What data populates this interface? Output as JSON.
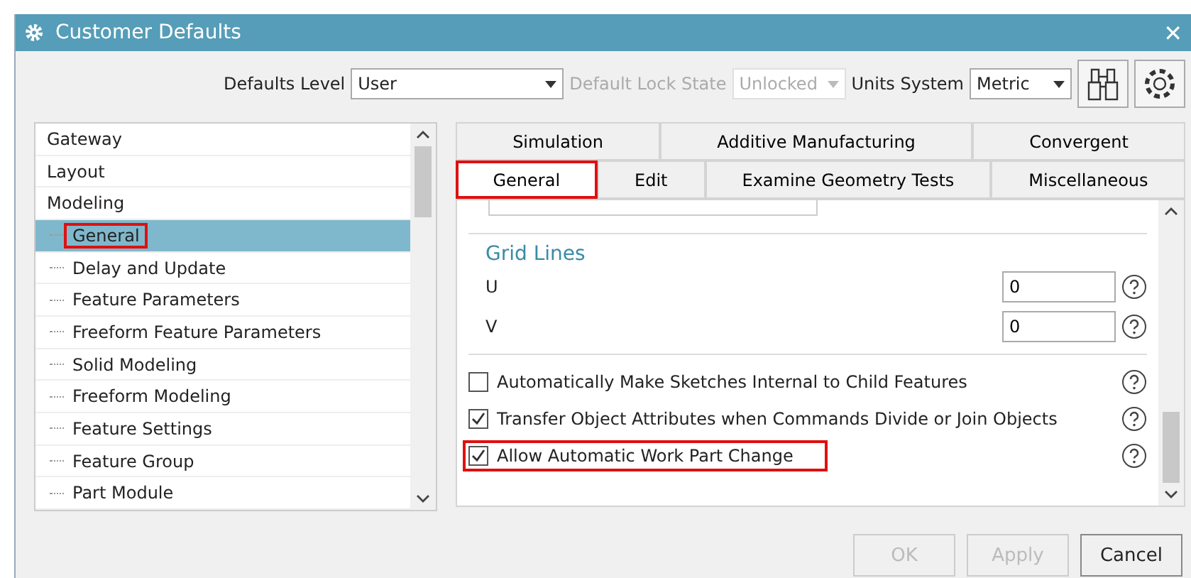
{
  "window": {
    "title": "Customer Defaults",
    "close": "✕"
  },
  "toolbar": {
    "defaults_level": {
      "label": "Defaults Level",
      "value": "User",
      "disabled": false
    },
    "lock_state": {
      "label": "Default Lock State",
      "value": "Unlocked",
      "disabled": true
    },
    "units": {
      "label": "Units System",
      "value": "Metric",
      "disabled": false
    }
  },
  "tree": {
    "items": [
      {
        "label": "Gateway",
        "selected": false,
        "annotated": false
      },
      {
        "label": "Layout",
        "selected": false,
        "annotated": false
      },
      {
        "label": "Modeling",
        "selected": false,
        "annotated": false,
        "children": [
          {
            "label": "General",
            "selected": true,
            "annotated": true
          },
          {
            "label": "Delay and Update",
            "selected": false,
            "annotated": false
          },
          {
            "label": "Feature Parameters",
            "selected": false,
            "annotated": false
          },
          {
            "label": "Freeform Feature Parameters",
            "selected": false,
            "annotated": false
          },
          {
            "label": "Solid Modeling",
            "selected": false,
            "annotated": false
          },
          {
            "label": "Freeform Modeling",
            "selected": false,
            "annotated": false
          },
          {
            "label": "Feature Settings",
            "selected": false,
            "annotated": false
          },
          {
            "label": "Feature Group",
            "selected": false,
            "annotated": false
          },
          {
            "label": "Part Module",
            "selected": false,
            "annotated": false
          }
        ]
      }
    ]
  },
  "tab_rows": [
    [
      {
        "label": "Simulation",
        "selected": false,
        "annotated": false
      },
      {
        "label": "Additive Manufacturing",
        "selected": false,
        "annotated": false
      },
      {
        "label": "Convergent",
        "selected": false,
        "annotated": false
      }
    ],
    [
      {
        "label": "General",
        "selected": true,
        "annotated": true
      },
      {
        "label": "Edit",
        "selected": false,
        "annotated": false
      },
      {
        "label": "Examine Geometry Tests",
        "selected": false,
        "annotated": false
      },
      {
        "label": "Miscellaneous",
        "selected": false,
        "annotated": false
      }
    ]
  ],
  "grid_lines": {
    "title": "Grid Lines",
    "fields": [
      {
        "label": "U",
        "value": "0"
      },
      {
        "label": "V",
        "value": "0"
      }
    ]
  },
  "options": [
    {
      "label": "Automatically Make Sketches Internal to Child Features",
      "checked": false,
      "annotated": false
    },
    {
      "label": "Transfer Object Attributes when Commands Divide or Join Objects",
      "checked": true,
      "annotated": false
    },
    {
      "label": "Allow Automatic Work Part Change",
      "checked": true,
      "annotated": true
    }
  ],
  "buttons": [
    {
      "label": "OK",
      "disabled": true
    },
    {
      "label": "Apply",
      "disabled": true
    },
    {
      "label": "Cancel",
      "disabled": false
    }
  ]
}
